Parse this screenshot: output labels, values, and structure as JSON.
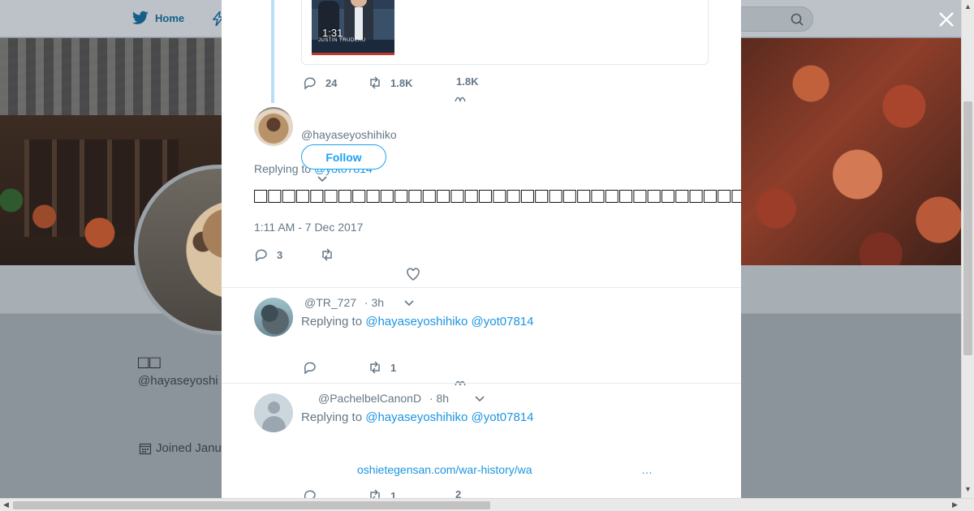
{
  "topbar": {
    "home_label": "Home"
  },
  "profile": {
    "name": "□□",
    "handle": "@hayaseyoshi",
    "joined": "Joined Janua"
  },
  "quoted": {
    "duration": "1:31",
    "caption": "JUSTIN TRUDEAU",
    "text_fragment": "♥♥ □□□□□□",
    "stats": {
      "replies": "24",
      "retweets": "1.8K",
      "likes": "1.8K"
    }
  },
  "main_tweet": {
    "handle": "@hayaseyoshihiko",
    "follow_label": "Follow",
    "replying_prefix": "Replying to ",
    "replying_to": "@yot07814",
    "text": "□□□□□□□□□□□□□□□□□□□□□□□□□□□□□□□□□□□□□□□□□□□□□□□□□□□□□□□□□□□",
    "timestamp": "1:11 AM - 7 Dec 2017",
    "stats": {
      "replies": "3"
    }
  },
  "replies": [
    {
      "handle": "@TR_727",
      "time": "· 3h",
      "replying_prefix": "Replying to ",
      "mention1": "@hayaseyoshihiko",
      "mention2": "@yot07814",
      "retweets": "1"
    },
    {
      "handle": "@PachelbelCanonD",
      "time": "· 8h",
      "replying_prefix": "Replying to ",
      "mention1": "@hayaseyoshihiko",
      "mention2": "@yot07814",
      "link": "oshietegensan.com/war-history/wa",
      "ellipsis": "…",
      "retweets": "1",
      "likes": "2"
    }
  ],
  "colors": {
    "accent": "#1da1f2",
    "link": "#1b95e0",
    "muted": "#657786"
  }
}
